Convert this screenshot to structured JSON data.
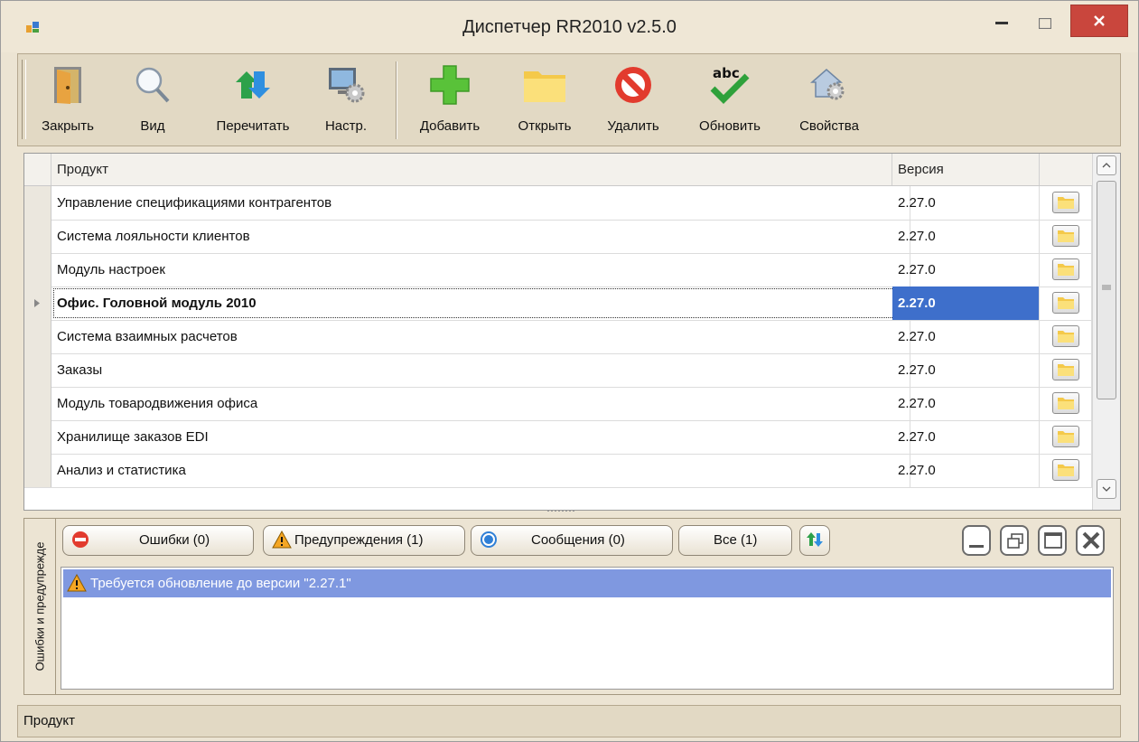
{
  "window": {
    "title": "Диспетчер RR2010 v2.5.0"
  },
  "toolbar": {
    "buttons": [
      {
        "label": "Закрыть",
        "icon": "door-exit-icon"
      },
      {
        "label": "Вид",
        "icon": "magnifier-icon"
      },
      {
        "label": "Перечитать",
        "icon": "refresh-arrows-icon"
      },
      {
        "label": "Настр.",
        "icon": "monitor-gear-icon"
      },
      {
        "label": "Добавить",
        "icon": "plus-icon"
      },
      {
        "label": "Открыть",
        "icon": "folder-icon"
      },
      {
        "label": "Удалить",
        "icon": "no-entry-icon"
      },
      {
        "label": "Обновить",
        "icon": "spellcheck-icon"
      },
      {
        "label": "Свойства",
        "icon": "house-gear-icon"
      }
    ]
  },
  "grid": {
    "columns": [
      "Продукт",
      "Версия"
    ],
    "selected_index": 3,
    "rows": [
      {
        "product": "Управление спецификациями контрагентов",
        "version": "2.27.0"
      },
      {
        "product": "Система лояльности клиентов",
        "version": "2.27.0"
      },
      {
        "product": "Модуль настроек",
        "version": "2.27.0"
      },
      {
        "product": "Офис. Головной модуль 2010",
        "version": "2.27.0"
      },
      {
        "product": "Система взаимных расчетов",
        "version": "2.27.0"
      },
      {
        "product": "Заказы",
        "version": "2.27.0"
      },
      {
        "product": "Модуль товародвижения офиса",
        "version": "2.27.0"
      },
      {
        "product": "Хранилище заказов EDI",
        "version": "2.27.0"
      },
      {
        "product": "Анализ и статистика",
        "version": "2.27.0"
      }
    ]
  },
  "panel": {
    "tab_label": "Ошибки и предупрежде",
    "filters": {
      "errors": "Ошибки (0)",
      "warnings": "Предупреждения (1)",
      "messages": "Сообщения (0)",
      "all": "Все (1)"
    },
    "messages": [
      {
        "icon": "warning-icon",
        "text": "Требуется обновление до версии \"2.27.1\""
      }
    ]
  },
  "statusbar": {
    "text": "Продукт"
  },
  "colors": {
    "selection": "#3e6fcb",
    "message_highlight": "#7f98e0",
    "close_button": "#c9463d"
  }
}
